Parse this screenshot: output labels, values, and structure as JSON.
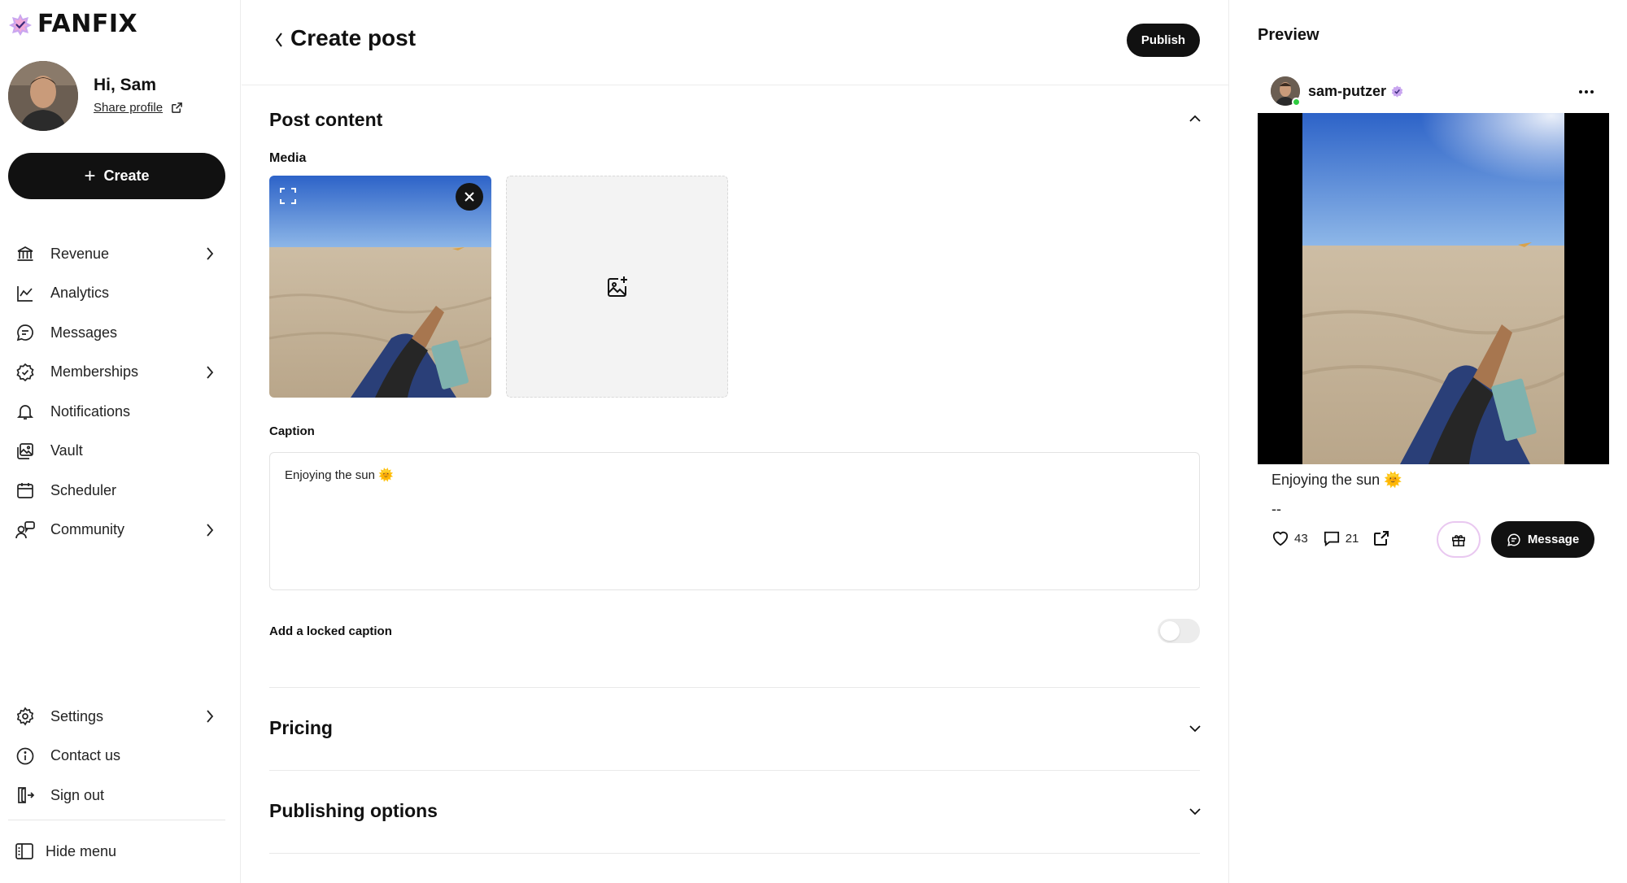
{
  "app": {
    "brand": "FANFIX"
  },
  "sidebar": {
    "greeting": "Hi, Sam",
    "share_profile": "Share profile",
    "create_label": "Create",
    "items": [
      {
        "label": "Revenue",
        "icon": "bank-icon",
        "has_chevron": true
      },
      {
        "label": "Analytics",
        "icon": "chart-line-icon",
        "has_chevron": false
      },
      {
        "label": "Messages",
        "icon": "chat-icon",
        "has_chevron": false
      },
      {
        "label": "Memberships",
        "icon": "badge-check-icon",
        "has_chevron": true
      },
      {
        "label": "Notifications",
        "icon": "bell-icon",
        "has_chevron": false
      },
      {
        "label": "Vault",
        "icon": "gallery-icon",
        "has_chevron": false
      },
      {
        "label": "Scheduler",
        "icon": "calendar-icon",
        "has_chevron": false
      },
      {
        "label": "Community",
        "icon": "community-icon",
        "has_chevron": true
      }
    ],
    "bottom_items": [
      {
        "label": "Settings",
        "icon": "gear-icon",
        "has_chevron": true
      },
      {
        "label": "Contact us",
        "icon": "info-icon",
        "has_chevron": false
      },
      {
        "label": "Sign out",
        "icon": "sign-out-icon",
        "has_chevron": false
      }
    ],
    "hide_menu": "Hide menu"
  },
  "header": {
    "title": "Create post",
    "publish_label": "Publish"
  },
  "post_content": {
    "title": "Post content",
    "media_label": "Media",
    "caption_label": "Caption",
    "caption_value": "Enjoying the sun 🌞",
    "locked_caption_label": "Add a locked caption",
    "locked_caption_enabled": false
  },
  "pricing": {
    "title": "Pricing"
  },
  "publishing": {
    "title": "Publishing options"
  },
  "preview": {
    "title": "Preview",
    "username": "sam-putzer",
    "caption": "Enjoying the sun 🌞",
    "separator": "--",
    "likes": "43",
    "comments": "21",
    "message_label": "Message"
  },
  "colors": {
    "primary": "#111111",
    "verified": "#b57bd9",
    "online": "#2ecc40"
  }
}
